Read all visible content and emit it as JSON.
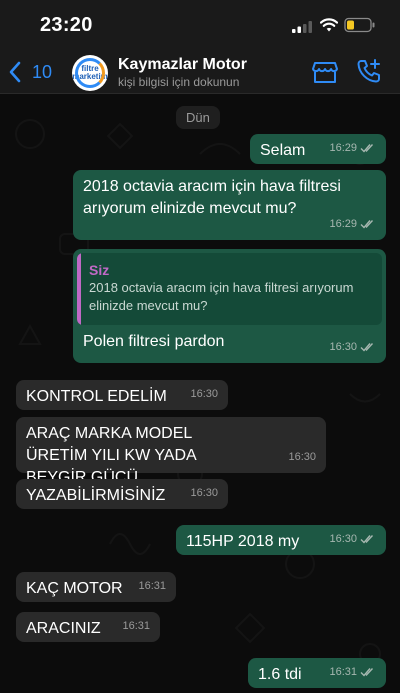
{
  "status_bar": {
    "time": "23:20"
  },
  "header": {
    "back_count": "10",
    "contact_name": "Kaymazlar Motor",
    "subtitle": "kişi bilgisi için dokunun",
    "avatar_text": "filtre marketim"
  },
  "chat": {
    "day_label": "Dün",
    "messages": [
      {
        "direction": "out",
        "text": "Selam",
        "time": "16:29"
      },
      {
        "direction": "out",
        "text": "2018 octavia aracım için hava filtresi arıyorum elinizde mevcut mu?",
        "time": "16:29"
      },
      {
        "direction": "out",
        "quoted_sender": "Siz",
        "quoted_text": "2018 octavia aracım için hava filtresi arıyorum elinizde mevcut mu?",
        "text": "Polen filtresi pardon",
        "time": "16:30"
      },
      {
        "direction": "in",
        "text": "KONTROL EDELİM",
        "time": "16:30"
      },
      {
        "direction": "in",
        "text": "ARAÇ MARKA MODEL ÜRETİM YILI KW YADA BEYGİR GÜCÜ",
        "time": "16:30"
      },
      {
        "direction": "in",
        "text": "YAZABİLİRMİSİNİZ",
        "time": "16:30"
      },
      {
        "direction": "out",
        "text": "115HP 2018 my",
        "time": "16:30"
      },
      {
        "direction": "in",
        "text": "KAÇ MOTOR",
        "time": "16:31"
      },
      {
        "direction": "in",
        "text": "ARACINIZ",
        "time": "16:31"
      },
      {
        "direction": "out",
        "text": "1.6 tdi",
        "time": "16:31"
      }
    ]
  },
  "colors": {
    "outgoing": "#1d5844",
    "incoming": "#2a2a2a",
    "accent": "#2f8bf5",
    "quote_name": "#c069c6"
  }
}
